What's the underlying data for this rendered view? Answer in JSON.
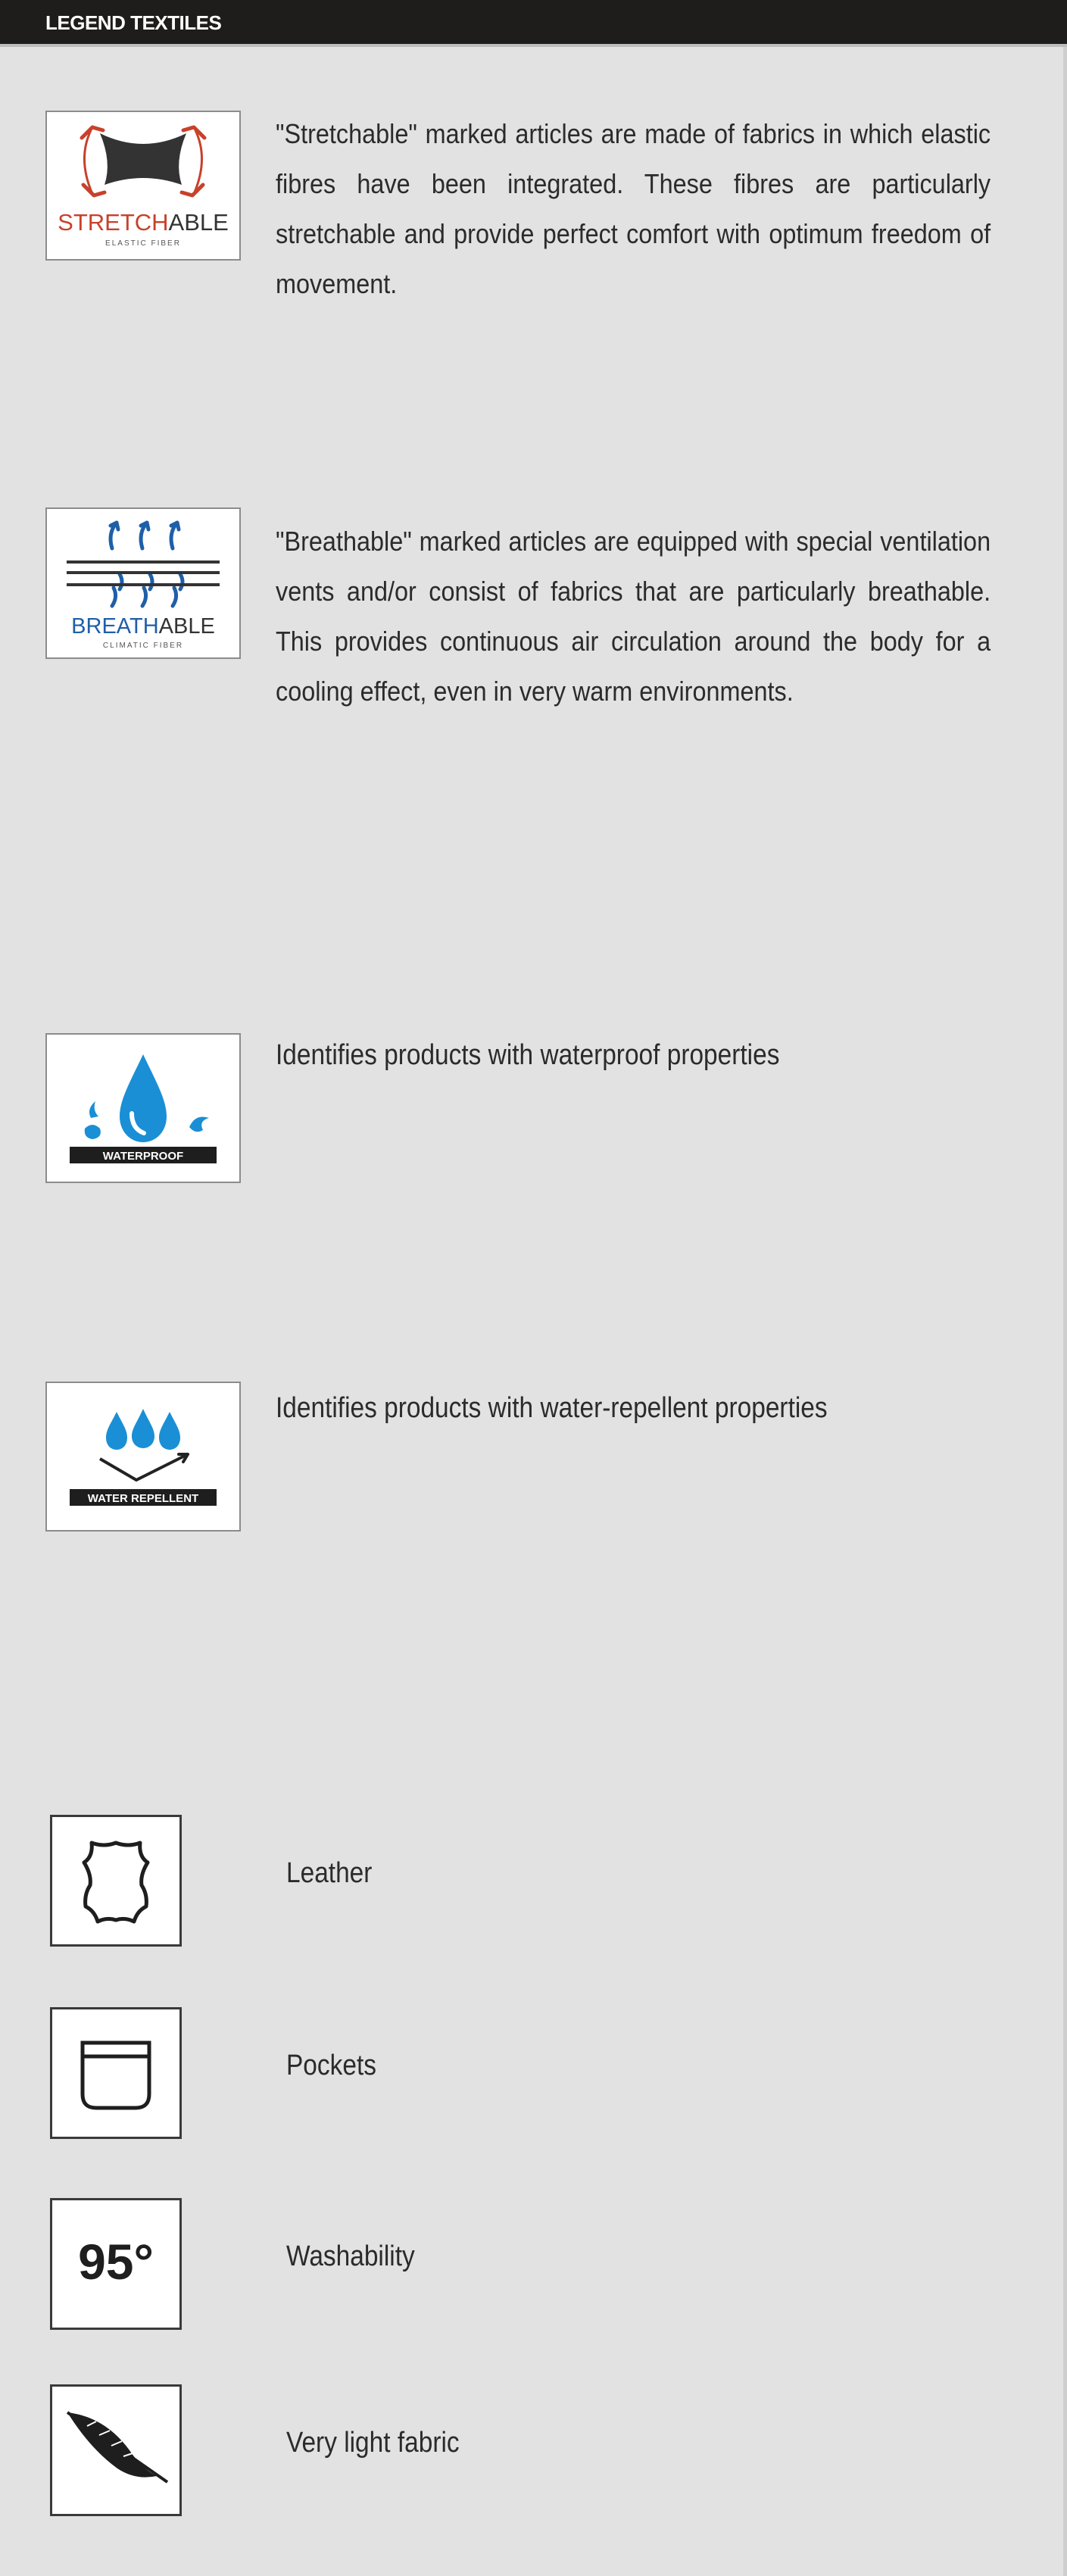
{
  "header": {
    "title": "LEGEND TEXTILES"
  },
  "stretchable": {
    "badge_word_a": "STRETCH",
    "badge_word_b": "ABLE",
    "badge_sub": "ELASTIC FIBER",
    "accent_color": "#c8412b",
    "description": "\"Stretchable\" marked articles are made of fabrics in which elastic fibres have been integrated. These fibres are particularly stretchable and provide perfect comfort with optimum freedom of movement."
  },
  "breathable": {
    "badge_word_a": "BREATH",
    "badge_word_b": "ABLE",
    "badge_sub": "CLIMATIC FIBER",
    "accent_color": "#1f5fa8",
    "description": "\"Breathable\" marked articles are equipped with special ventilation vents and/or consist of fabrics that are particularly breathable. This provides continuous air circulation around the body for a cooling effect, even in very warm environments."
  },
  "waterproof": {
    "badge_label": "WATERPROOF",
    "accent_color": "#1a8fd6",
    "description": "Identifies products with waterproof properties"
  },
  "water_repellent": {
    "badge_label": "WATER REPELLENT",
    "accent_color": "#1a8fd6",
    "description": "Identifies products with water-repellent properties"
  },
  "features": [
    {
      "icon": "leather-hide-icon",
      "label": "Leather"
    },
    {
      "icon": "pocket-icon",
      "label": "Pockets"
    },
    {
      "icon": "washability-95-icon",
      "label": "Washability",
      "icon_text": "95°"
    },
    {
      "icon": "feather-icon",
      "label": "Very light fabric"
    }
  ]
}
